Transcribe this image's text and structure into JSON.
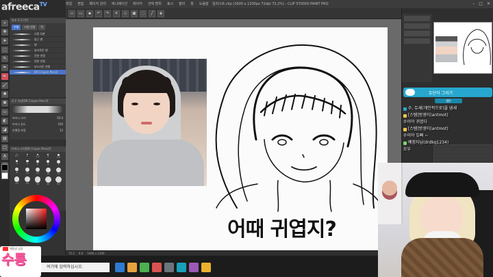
{
  "window": {
    "title": "일러스트.clip (1600 x 1200px 72dpi 72.2%) - CLIP STUDIO PAINT PRO",
    "menu": [
      "파일",
      "편집",
      "페이지 관리",
      "애니메이션",
      "레이어",
      "선택 범위",
      "표시",
      "필터",
      "창",
      "도움말"
    ]
  },
  "logo": {
    "brand": "afreeca",
    "suffix": "TV"
  },
  "left_panel": {
    "subtool_header": "보조 도구 [붓]",
    "tabs": [
      "수채",
      "리얼 연필",
      "먹"
    ],
    "brushes": [
      {
        "label": "리얼 G펜",
        "selected": false
      },
      {
        "label": "둥근 펜",
        "selected": false
      },
      {
        "label": "펜",
        "selected": false
      },
      {
        "label": "날카로운 펜",
        "selected": false
      },
      {
        "label": "진한 연필",
        "selected": false
      },
      {
        "label": "연한 연필",
        "selected": false
      },
      {
        "label": "부드러운 연필",
        "selected": false
      },
      {
        "label": "DR Crayon Pencil",
        "selected": true
      }
    ],
    "tool_property_header": "도구 속성[DR Crayon Pencil]",
    "properties": [
      {
        "label": "브러시 크기",
        "value": "50.0"
      },
      {
        "label": "브러시 농도",
        "value": "100"
      },
      {
        "label": "손떨림 보정",
        "value": "12"
      }
    ],
    "brush_size_header": "브러시 크기[DR Crayon Pencil]",
    "sizes": [
      "0.7",
      "1",
      "1.5",
      "2",
      "2.5",
      "3",
      "4",
      "5",
      "6",
      "7",
      "8",
      "10",
      "12",
      "15",
      "17",
      "20",
      "25",
      "30",
      "40",
      "50"
    ]
  },
  "canvas": {
    "caption": "어때 귀엽지?"
  },
  "status": {
    "zoom": "72.2",
    "angle": "0.0",
    "coords": "1600 x 1200"
  },
  "chat": {
    "title": "듀단이 그리기",
    "sub": "열린",
    "messages": [
      {
        "text": "수, 듀셰(개인적으로)을 냄새",
        "badge": "#27a7ce"
      },
      {
        "text": "[스템]방생이(antmot)",
        "badge": "#f2c94c"
      },
      {
        "text": "수이야 귀엽다",
        "badge": ""
      },
      {
        "text": "[스템]방생이(antmot)",
        "badge": "#f2c94c"
      },
      {
        "text": "수이야 듀빠 ~",
        "badge": ""
      },
      {
        "text": "예정자님(drdkq1234)",
        "badge": "#7bd56b"
      },
      {
        "text": "오우",
        "badge": ""
      }
    ]
  },
  "taskbar": {
    "search_placeholder": "여기에 입력하십시오.",
    "apps": [
      "#2e7ad1",
      "#e6a23c",
      "#4caf50",
      "#d9534f",
      "#6c757d",
      "#19a0b8",
      "#9b59b6",
      "#ecb22e"
    ]
  },
  "sticker": {
    "top_text": "채팅방 입장",
    "big_text": "수툥"
  },
  "colors": {
    "accent": "#4a74c8",
    "chat_header": "#27a7ce",
    "sticker_pink": "#ff5a9e"
  }
}
